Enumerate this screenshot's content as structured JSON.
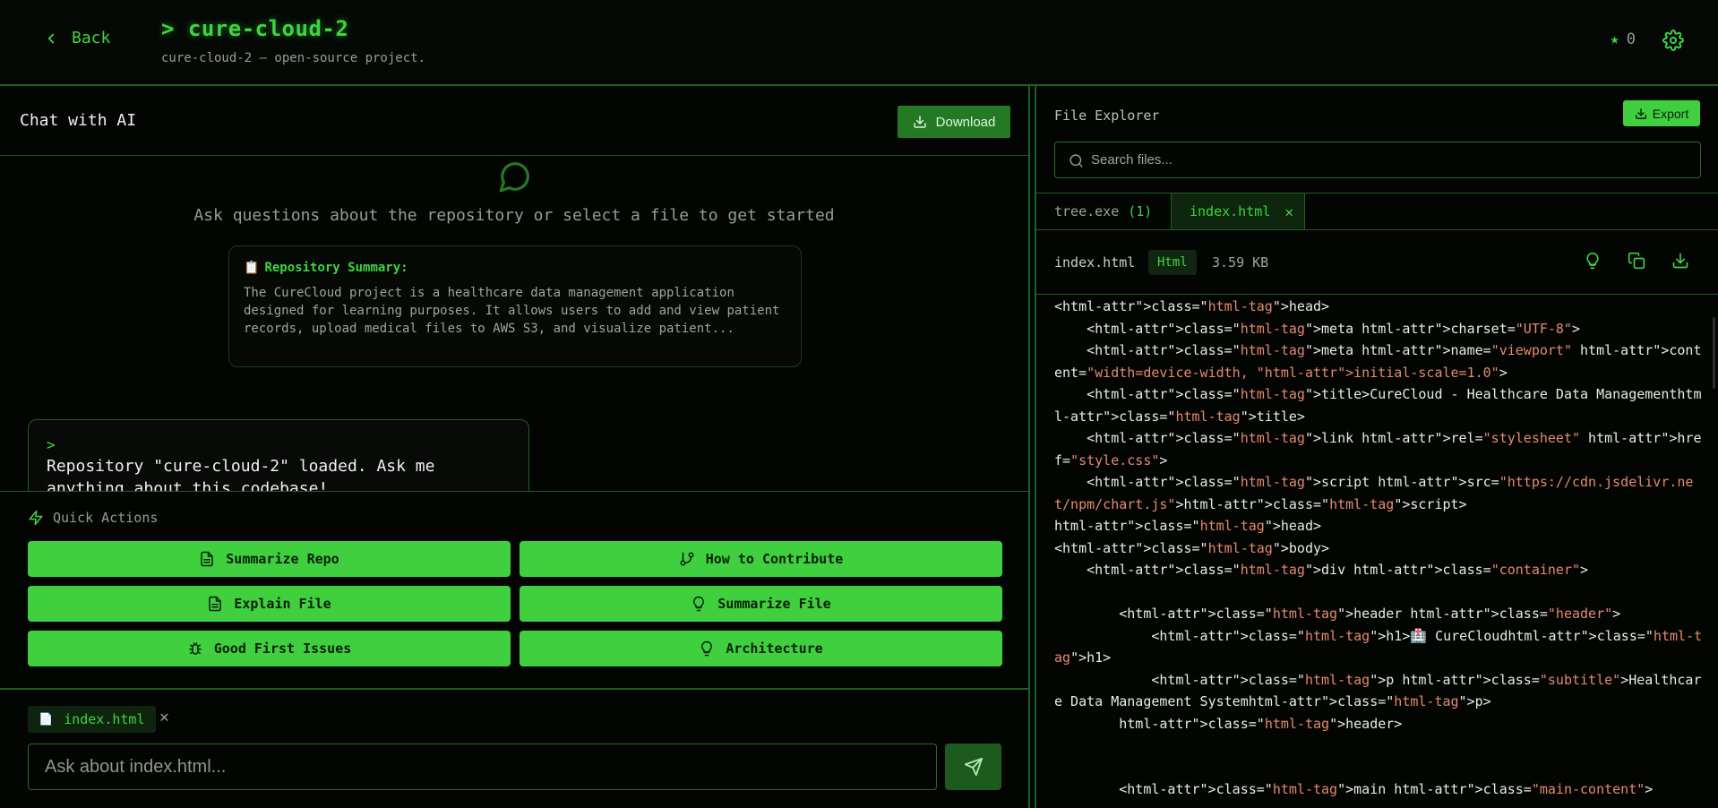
{
  "header": {
    "back_label": "Back",
    "title": "> cure-cloud-2",
    "subtitle": "cure-cloud-2 — open-source project.",
    "star_count": "0"
  },
  "chat": {
    "title": "Chat with AI",
    "download_label": "Download",
    "prompt_hint": "Ask questions about the repository or select a file to get started",
    "summary_title": "Repository Summary:",
    "summary_text": "The CureCloud project is a healthcare data management application designed for learning purposes. It allows users to add and view patient records, upload medical files to AWS S3, and visualize patient...",
    "message_caret": ">",
    "message_text": "Repository \"cure-cloud-2\" loaded. Ask me anything about this codebase!"
  },
  "quick_actions": {
    "label": "Quick Actions",
    "buttons": [
      {
        "label": "Summarize Repo",
        "icon": "file-text-icon"
      },
      {
        "label": "How to Contribute",
        "icon": "git-branch-icon"
      },
      {
        "label": "Explain File",
        "icon": "file-text-icon"
      },
      {
        "label": "Summarize File",
        "icon": "lightbulb-icon"
      },
      {
        "label": "Good First Issues",
        "icon": "bug-icon"
      },
      {
        "label": "Architecture",
        "icon": "lightbulb-icon"
      }
    ]
  },
  "composer": {
    "file_chip": "index.html",
    "placeholder": "Ask about index.html..."
  },
  "explorer": {
    "title": "File Explorer",
    "export_label": "Export",
    "search_placeholder": "Search files...",
    "tab_tree": "tree.exe",
    "tab_tree_count": "(1)",
    "tab_file": "index.html",
    "file_name": "index.html",
    "file_lang": "Html",
    "file_size": "3.59 KB"
  },
  "code_lines": [
    [
      [
        "t",
        "<html-attr\">class=\""
      ],
      [
        "s",
        "html-tag"
      ],
      [
        "t",
        "\">head>"
      ]
    ],
    [
      [
        "t",
        "    <html-attr\">class=\""
      ],
      [
        "s",
        "html-tag"
      ],
      [
        "t",
        "\">meta html-attr\">charset="
      ],
      [
        "s",
        "\"UTF-8\""
      ],
      [
        "t",
        ">"
      ]
    ],
    [
      [
        "t",
        "    <html-attr\">class=\""
      ],
      [
        "s",
        "html-tag"
      ],
      [
        "t",
        "\">meta html-attr\">name="
      ],
      [
        "s",
        "\"viewport\""
      ],
      [
        "t",
        " html-attr\">content="
      ],
      [
        "s",
        "\"width=device-width, \"html-attr\">initial-scale=1.0\""
      ],
      [
        "t",
        ">"
      ]
    ],
    [
      [
        "t",
        "    <html-attr\">class=\""
      ],
      [
        "s",
        "html-tag"
      ],
      [
        "t",
        "\">title>CureCloud - Healthcare Data Managementhtml-attr\">class=\""
      ],
      [
        "s",
        "html-tag"
      ],
      [
        "t",
        "\">title>"
      ]
    ],
    [
      [
        "t",
        "    <html-attr\">class=\""
      ],
      [
        "s",
        "html-tag"
      ],
      [
        "t",
        "\">link html-attr\">rel="
      ],
      [
        "s",
        "\"stylesheet\""
      ],
      [
        "t",
        " html-attr\">href="
      ],
      [
        "s",
        "\"style.css\""
      ],
      [
        "t",
        ">"
      ]
    ],
    [
      [
        "t",
        "    <html-attr\">class=\""
      ],
      [
        "s",
        "html-tag"
      ],
      [
        "t",
        "\">script html-attr\">src="
      ],
      [
        "s",
        "\"https://cdn.jsdelivr.net/npm/chart.js\""
      ],
      [
        "t",
        ">html-attr\">class=\""
      ],
      [
        "s",
        "html-tag"
      ],
      [
        "t",
        "\">script>"
      ]
    ],
    [
      [
        "t",
        "html-attr\">class=\""
      ],
      [
        "s",
        "html-tag"
      ],
      [
        "t",
        "\">head>"
      ]
    ],
    [
      [
        "t",
        "<html-attr\">class=\""
      ],
      [
        "s",
        "html-tag"
      ],
      [
        "t",
        "\">body>"
      ]
    ],
    [
      [
        "t",
        "    <html-attr\">class=\""
      ],
      [
        "s",
        "html-tag"
      ],
      [
        "t",
        "\">div html-attr\">class="
      ],
      [
        "s",
        "\"container\""
      ],
      [
        "t",
        ">"
      ]
    ],
    [
      [
        "t",
        " "
      ]
    ],
    [
      [
        "t",
        "        <html-attr\">class=\""
      ],
      [
        "s",
        "html-tag"
      ],
      [
        "t",
        "\">header html-attr\">class="
      ],
      [
        "s",
        "\"header\""
      ],
      [
        "t",
        ">"
      ]
    ],
    [
      [
        "t",
        "            <html-attr\">class=\""
      ],
      [
        "s",
        "html-tag"
      ],
      [
        "t",
        "\">h1>🏥 CureCloudhtml-attr\">class=\""
      ],
      [
        "s",
        "html-tag"
      ],
      [
        "t",
        "\">h1>"
      ]
    ],
    [
      [
        "t",
        "            <html-attr\">class=\""
      ],
      [
        "s",
        "html-tag"
      ],
      [
        "t",
        "\">p html-attr\">class="
      ],
      [
        "s",
        "\"subtitle\""
      ],
      [
        "t",
        ">Healthcare Data Management Systemhtml-attr\">class=\""
      ],
      [
        "s",
        "html-tag"
      ],
      [
        "t",
        "\">p>"
      ]
    ],
    [
      [
        "t",
        "        html-attr\">class=\""
      ],
      [
        "s",
        "html-tag"
      ],
      [
        "t",
        "\">header>"
      ]
    ],
    [
      [
        "t",
        " "
      ]
    ],
    [
      [
        "t",
        " "
      ]
    ],
    [
      [
        "t",
        "        <html-attr\">class=\""
      ],
      [
        "s",
        "html-tag"
      ],
      [
        "t",
        "\">main html-attr\">class="
      ],
      [
        "s",
        "\"main-content\""
      ],
      [
        "t",
        ">"
      ]
    ]
  ]
}
